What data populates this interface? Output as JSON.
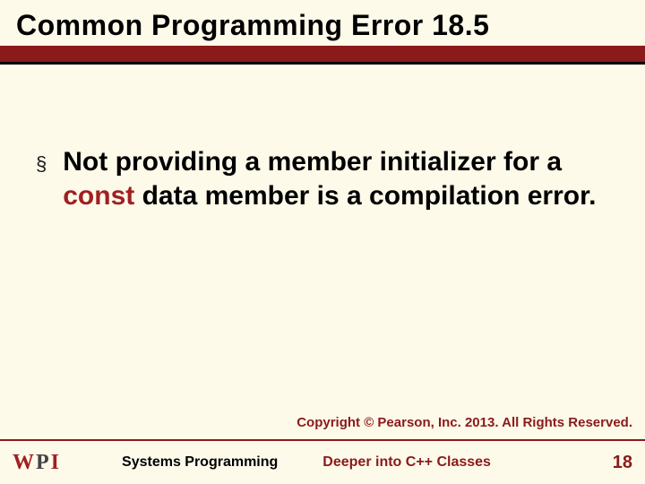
{
  "title": "Common Programming Error 18.5",
  "body": {
    "pre": "Not providing a member initializer for a ",
    "const": "const",
    "post": " data member is a compilation error."
  },
  "copyright": "Copyright © Pearson, Inc. 2013. All Rights Reserved.",
  "footer": {
    "logo_w": "W",
    "logo_p": "P",
    "logo_i": "I",
    "mid": "Systems Programming",
    "right": "Deeper into C++ Classes",
    "page": "18"
  }
}
